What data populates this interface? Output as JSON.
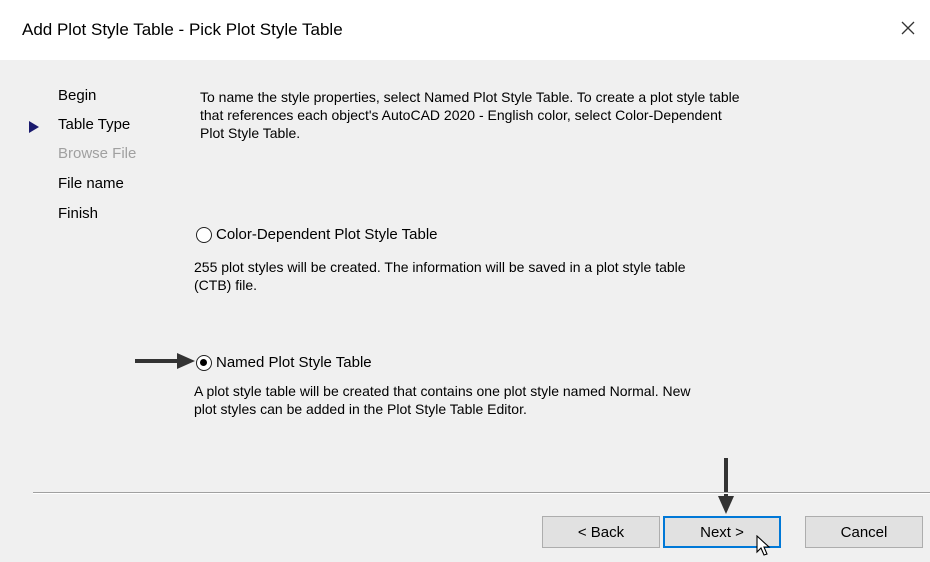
{
  "window": {
    "title": "Add Plot Style Table - Pick Plot Style Table",
    "close_icon": "close-icon"
  },
  "nav": {
    "items": [
      {
        "label": "Begin",
        "state": "normal"
      },
      {
        "label": "Table Type",
        "state": "current"
      },
      {
        "label": "Browse File",
        "state": "disabled"
      },
      {
        "label": "File name",
        "state": "normal"
      },
      {
        "label": "Finish",
        "state": "normal"
      }
    ],
    "current_marker_color": "#1a1a6e"
  },
  "content": {
    "description": "To name the style properties, select Named Plot Style Table. To create a plot style table that references each object's AutoCAD 2020 - English color, select Color-Dependent Plot Style Table.",
    "options": [
      {
        "label": "Color-Dependent Plot Style Table",
        "description": "255 plot styles will be created. The information will be saved in a plot style table (CTB) file.",
        "selected": false
      },
      {
        "label": "Named Plot Style Table",
        "description": "A plot style table will be created that contains one plot style named Normal.  New plot styles can be added in the Plot Style Table Editor.",
        "selected": true
      }
    ]
  },
  "buttons": {
    "back": "< Back",
    "next": "Next >",
    "cancel": "Cancel"
  },
  "annotations": {
    "arrow_color": "#333333"
  }
}
